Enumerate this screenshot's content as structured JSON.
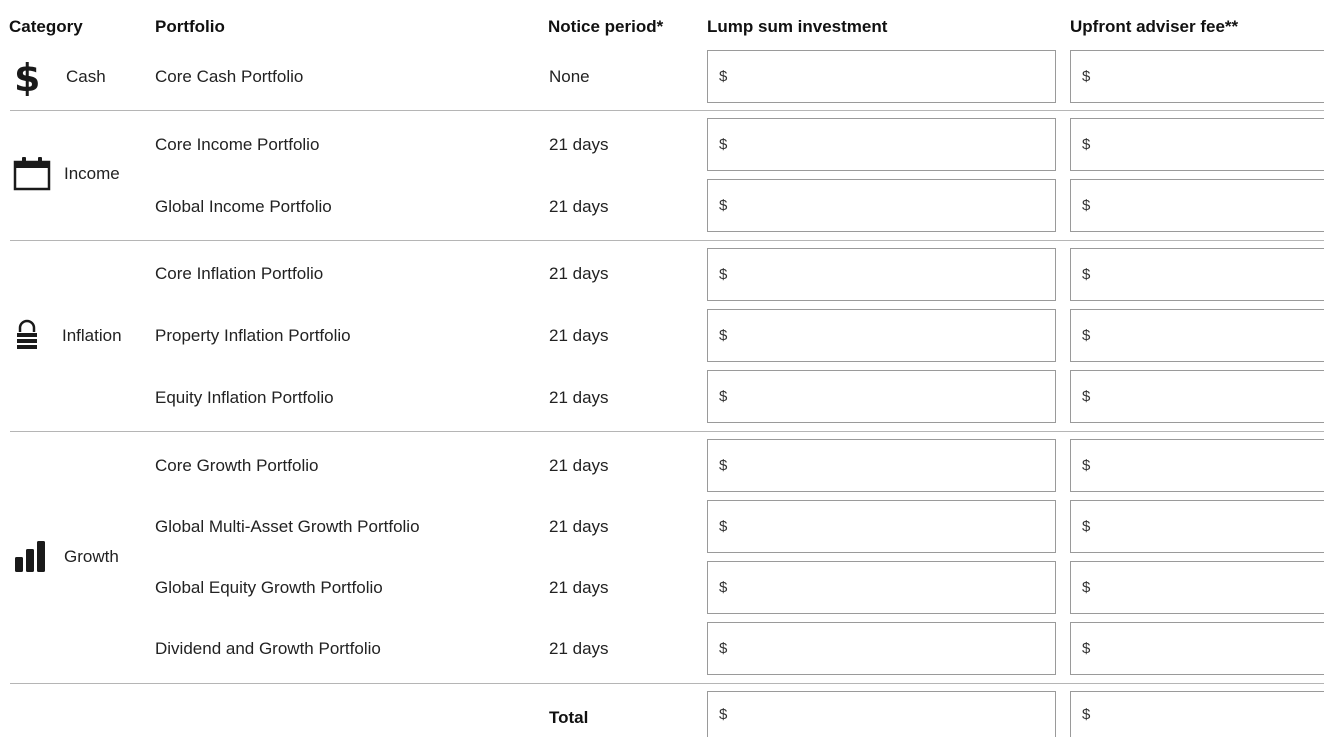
{
  "headers": {
    "category": "Category",
    "portfolio": "Portfolio",
    "notice": "Notice period*",
    "lump": "Lump sum investment",
    "fee": "Upfront adviser fee**"
  },
  "categories": {
    "cash": {
      "label": "Cash",
      "icon": "dollar-icon"
    },
    "income": {
      "label": "Income",
      "icon": "calendar-icon"
    },
    "inflation": {
      "label": "Inflation",
      "icon": "lock-icon"
    },
    "growth": {
      "label": "Growth",
      "icon": "bar-chart-icon"
    }
  },
  "rows": [
    {
      "portfolio": "Core Cash Portfolio",
      "notice": "None",
      "lump": "$",
      "fee": "$"
    },
    {
      "portfolio": "Core Income Portfolio",
      "notice": "21 days",
      "lump": "$",
      "fee": "$"
    },
    {
      "portfolio": "Global Income Portfolio",
      "notice": "21 days",
      "lump": "$",
      "fee": "$"
    },
    {
      "portfolio": "Core Inflation Portfolio",
      "notice": "21 days",
      "lump": "$",
      "fee": "$"
    },
    {
      "portfolio": "Property Inflation Portfolio",
      "notice": "21 days",
      "lump": "$",
      "fee": "$"
    },
    {
      "portfolio": "Equity Inflation Portfolio",
      "notice": "21 days",
      "lump": "$",
      "fee": "$"
    },
    {
      "portfolio": "Core Growth Portfolio",
      "notice": "21 days",
      "lump": "$",
      "fee": "$"
    },
    {
      "portfolio": "Global Multi-Asset Growth Portfolio",
      "notice": "21 days",
      "lump": "$",
      "fee": "$"
    },
    {
      "portfolio": "Global Equity Growth Portfolio",
      "notice": "21 days",
      "lump": "$",
      "fee": "$"
    },
    {
      "portfolio": "Dividend and Growth Portfolio",
      "notice": "21 days",
      "lump": "$",
      "fee": "$"
    }
  ],
  "total": {
    "label": "Total",
    "lump": "$",
    "fee": "$"
  }
}
